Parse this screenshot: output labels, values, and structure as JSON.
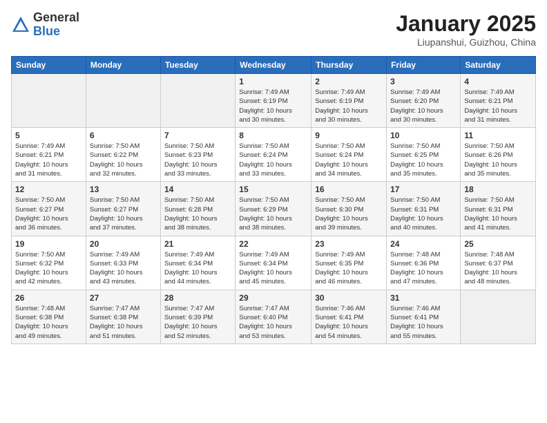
{
  "logo": {
    "general": "General",
    "blue": "Blue"
  },
  "title": "January 2025",
  "location": "Liupanshui, Guizhou, China",
  "weekdays": [
    "Sunday",
    "Monday",
    "Tuesday",
    "Wednesday",
    "Thursday",
    "Friday",
    "Saturday"
  ],
  "weeks": [
    [
      {
        "day": "",
        "info": ""
      },
      {
        "day": "",
        "info": ""
      },
      {
        "day": "",
        "info": ""
      },
      {
        "day": "1",
        "info": "Sunrise: 7:49 AM\nSunset: 6:19 PM\nDaylight: 10 hours\nand 30 minutes."
      },
      {
        "day": "2",
        "info": "Sunrise: 7:49 AM\nSunset: 6:19 PM\nDaylight: 10 hours\nand 30 minutes."
      },
      {
        "day": "3",
        "info": "Sunrise: 7:49 AM\nSunset: 6:20 PM\nDaylight: 10 hours\nand 30 minutes."
      },
      {
        "day": "4",
        "info": "Sunrise: 7:49 AM\nSunset: 6:21 PM\nDaylight: 10 hours\nand 31 minutes."
      }
    ],
    [
      {
        "day": "5",
        "info": "Sunrise: 7:49 AM\nSunset: 6:21 PM\nDaylight: 10 hours\nand 31 minutes."
      },
      {
        "day": "6",
        "info": "Sunrise: 7:50 AM\nSunset: 6:22 PM\nDaylight: 10 hours\nand 32 minutes."
      },
      {
        "day": "7",
        "info": "Sunrise: 7:50 AM\nSunset: 6:23 PM\nDaylight: 10 hours\nand 33 minutes."
      },
      {
        "day": "8",
        "info": "Sunrise: 7:50 AM\nSunset: 6:24 PM\nDaylight: 10 hours\nand 33 minutes."
      },
      {
        "day": "9",
        "info": "Sunrise: 7:50 AM\nSunset: 6:24 PM\nDaylight: 10 hours\nand 34 minutes."
      },
      {
        "day": "10",
        "info": "Sunrise: 7:50 AM\nSunset: 6:25 PM\nDaylight: 10 hours\nand 35 minutes."
      },
      {
        "day": "11",
        "info": "Sunrise: 7:50 AM\nSunset: 6:26 PM\nDaylight: 10 hours\nand 35 minutes."
      }
    ],
    [
      {
        "day": "12",
        "info": "Sunrise: 7:50 AM\nSunset: 6:27 PM\nDaylight: 10 hours\nand 36 minutes."
      },
      {
        "day": "13",
        "info": "Sunrise: 7:50 AM\nSunset: 6:27 PM\nDaylight: 10 hours\nand 37 minutes."
      },
      {
        "day": "14",
        "info": "Sunrise: 7:50 AM\nSunset: 6:28 PM\nDaylight: 10 hours\nand 38 minutes."
      },
      {
        "day": "15",
        "info": "Sunrise: 7:50 AM\nSunset: 6:29 PM\nDaylight: 10 hours\nand 38 minutes."
      },
      {
        "day": "16",
        "info": "Sunrise: 7:50 AM\nSunset: 6:30 PM\nDaylight: 10 hours\nand 39 minutes."
      },
      {
        "day": "17",
        "info": "Sunrise: 7:50 AM\nSunset: 6:31 PM\nDaylight: 10 hours\nand 40 minutes."
      },
      {
        "day": "18",
        "info": "Sunrise: 7:50 AM\nSunset: 6:31 PM\nDaylight: 10 hours\nand 41 minutes."
      }
    ],
    [
      {
        "day": "19",
        "info": "Sunrise: 7:50 AM\nSunset: 6:32 PM\nDaylight: 10 hours\nand 42 minutes."
      },
      {
        "day": "20",
        "info": "Sunrise: 7:49 AM\nSunset: 6:33 PM\nDaylight: 10 hours\nand 43 minutes."
      },
      {
        "day": "21",
        "info": "Sunrise: 7:49 AM\nSunset: 6:34 PM\nDaylight: 10 hours\nand 44 minutes."
      },
      {
        "day": "22",
        "info": "Sunrise: 7:49 AM\nSunset: 6:34 PM\nDaylight: 10 hours\nand 45 minutes."
      },
      {
        "day": "23",
        "info": "Sunrise: 7:49 AM\nSunset: 6:35 PM\nDaylight: 10 hours\nand 46 minutes."
      },
      {
        "day": "24",
        "info": "Sunrise: 7:48 AM\nSunset: 6:36 PM\nDaylight: 10 hours\nand 47 minutes."
      },
      {
        "day": "25",
        "info": "Sunrise: 7:48 AM\nSunset: 6:37 PM\nDaylight: 10 hours\nand 48 minutes."
      }
    ],
    [
      {
        "day": "26",
        "info": "Sunrise: 7:48 AM\nSunset: 6:38 PM\nDaylight: 10 hours\nand 49 minutes."
      },
      {
        "day": "27",
        "info": "Sunrise: 7:47 AM\nSunset: 6:38 PM\nDaylight: 10 hours\nand 51 minutes."
      },
      {
        "day": "28",
        "info": "Sunrise: 7:47 AM\nSunset: 6:39 PM\nDaylight: 10 hours\nand 52 minutes."
      },
      {
        "day": "29",
        "info": "Sunrise: 7:47 AM\nSunset: 6:40 PM\nDaylight: 10 hours\nand 53 minutes."
      },
      {
        "day": "30",
        "info": "Sunrise: 7:46 AM\nSunset: 6:41 PM\nDaylight: 10 hours\nand 54 minutes."
      },
      {
        "day": "31",
        "info": "Sunrise: 7:46 AM\nSunset: 6:41 PM\nDaylight: 10 hours\nand 55 minutes."
      },
      {
        "day": "",
        "info": ""
      }
    ]
  ]
}
